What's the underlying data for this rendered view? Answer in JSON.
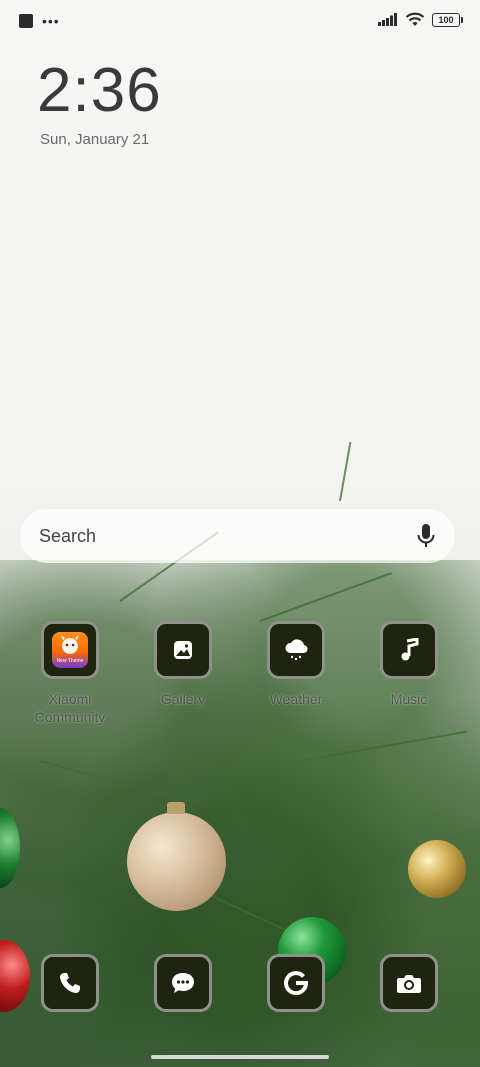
{
  "status_bar": {
    "battery_level": "100",
    "signal": "signal-bars-icon",
    "wifi": "wifi-icon"
  },
  "lockscreen": {
    "time": "2:36",
    "date": "Sun, January 21"
  },
  "search": {
    "placeholder": "Search"
  },
  "apps": [
    {
      "label": "Xiaomi\nCommunity",
      "icon": "xiaomi-community-icon"
    },
    {
      "label": "Gallery",
      "icon": "gallery-icon"
    },
    {
      "label": "Weather",
      "icon": "weather-icon"
    },
    {
      "label": "Music",
      "icon": "music-icon"
    }
  ],
  "dock": [
    {
      "icon": "phone-icon"
    },
    {
      "icon": "messages-icon"
    },
    {
      "icon": "google-icon"
    },
    {
      "icon": "camera-icon"
    }
  ],
  "colors": {
    "icon_bg": "#1f2410",
    "icon_border": "#8e928a",
    "text_dark": "#3a3a3a"
  }
}
